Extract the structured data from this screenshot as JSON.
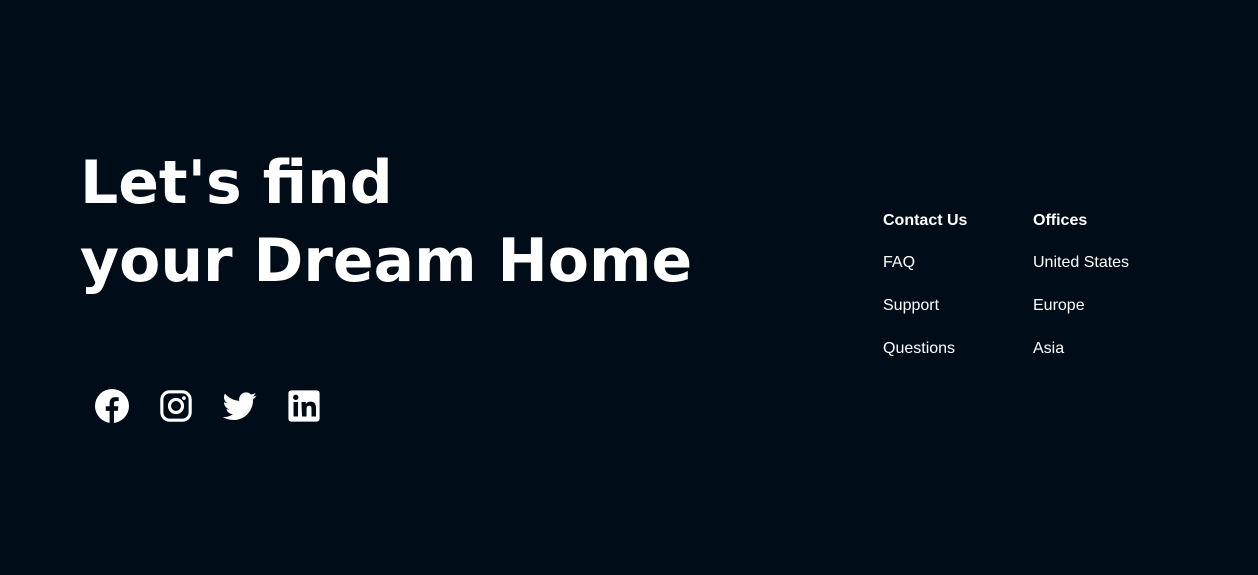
{
  "headline": {
    "line1": "Let's find",
    "line2": "your Dream Home"
  },
  "social": {
    "icons": [
      "facebook-icon",
      "instagram-icon",
      "twitter-icon",
      "linkedin-icon"
    ]
  },
  "contact": {
    "heading": "Contact Us",
    "links": [
      "FAQ",
      "Support",
      "Questions"
    ]
  },
  "offices": {
    "heading": "Offices",
    "links": [
      "United States",
      "Europe",
      "Asia"
    ]
  },
  "colors": {
    "background": "#000d18",
    "text": "#ffffff"
  }
}
